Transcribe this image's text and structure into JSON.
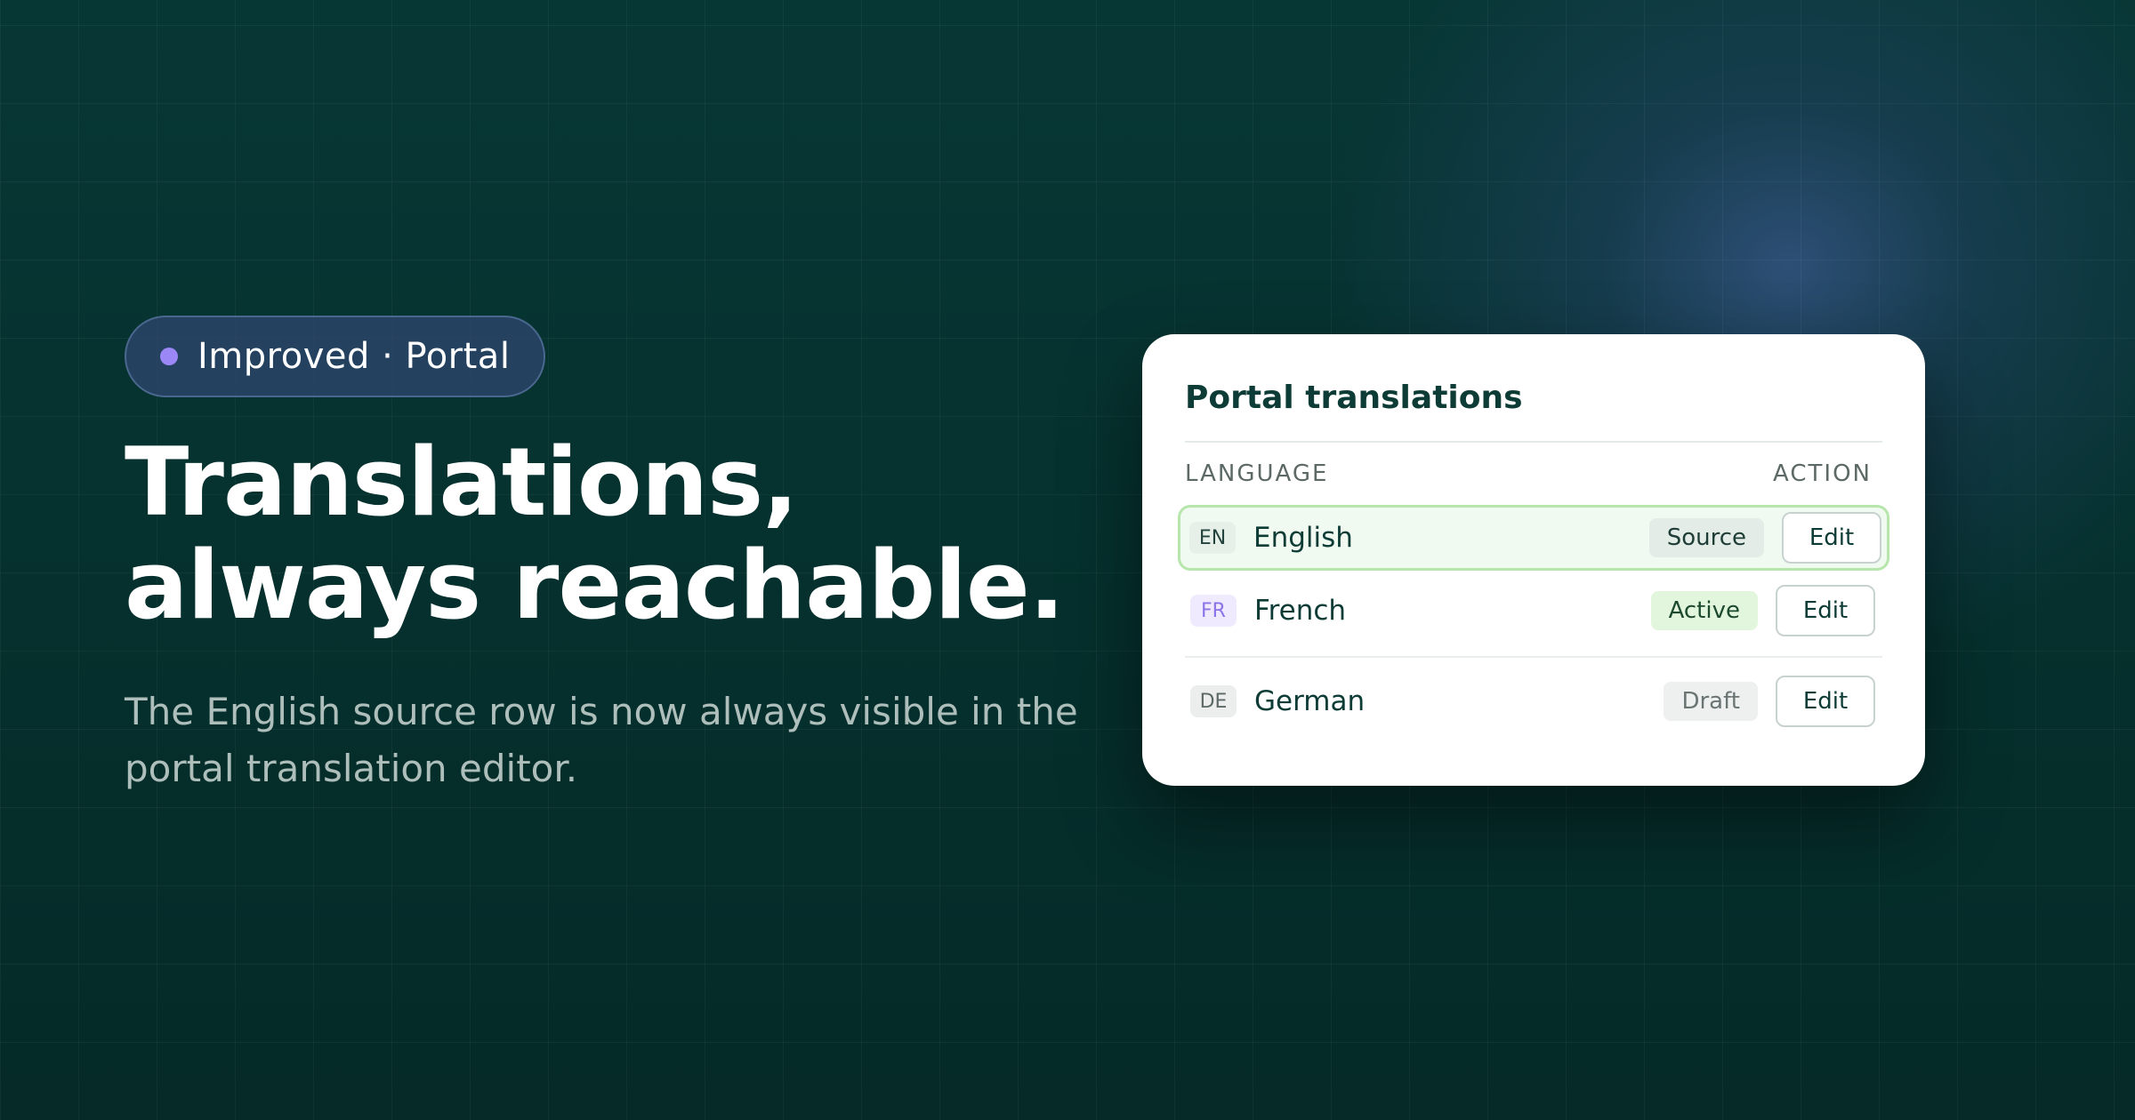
{
  "hero": {
    "tag_label": "Improved · Portal",
    "headline_line1": "Translations,",
    "headline_line2": "always reachable.",
    "subtext": "The English source row is now always visible in the portal translation editor."
  },
  "card": {
    "title": "Portal translations",
    "columns": {
      "language": "LANGUAGE",
      "action": "ACTION"
    },
    "rows": [
      {
        "code": "EN",
        "name": "English",
        "status": "Source",
        "action": "Edit"
      },
      {
        "code": "FR",
        "name": "French",
        "status": "Active",
        "action": "Edit"
      },
      {
        "code": "DE",
        "name": "German",
        "status": "Draft",
        "action": "Edit"
      }
    ]
  },
  "colors": {
    "background": "#06302e",
    "tag_dot": "#9b87f5",
    "source_highlight": "#b6e6ac",
    "heading_text": "#0d3b35"
  }
}
